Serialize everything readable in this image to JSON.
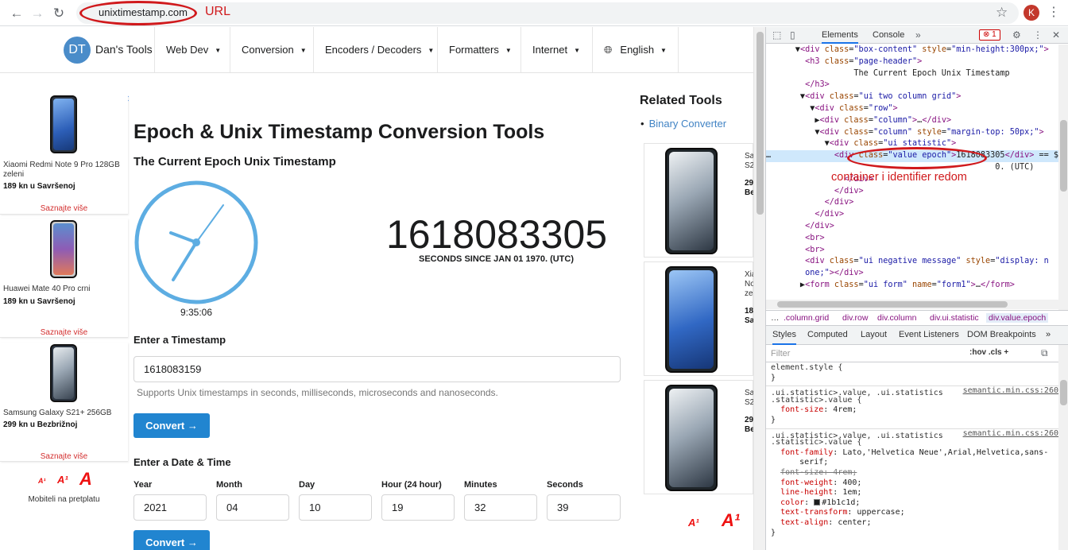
{
  "browser": {
    "url": "unixtimestamp.com",
    "url_annotation": "URL",
    "back_icon": "back-arrow-icon",
    "forward_icon": "forward-arrow-icon",
    "reload_icon": "reload-icon",
    "profile_initial": "K"
  },
  "site": {
    "logo_text": "DT",
    "brand_name": "Dan's Tools",
    "menu": [
      "Web Dev",
      "Conversion",
      "Encoders / Decoders",
      "Formatters",
      "Internet",
      "English"
    ]
  },
  "ads": [
    {
      "title": "Xiaomi Redmi Note 9 Pro 128GB zeleni",
      "price": "189 kn u Savršenoj",
      "link": "Saznajte više"
    },
    {
      "title": "Huawei Mate 40 Pro crni",
      "price": "189 kn u Savršenoj",
      "link": "Saznajte više"
    },
    {
      "title": "Samsung Galaxy S21+ 256GB",
      "price": "299 kn u Bezbrižnoj",
      "link": "Saznajte više"
    }
  ],
  "a1_caption": "Mobiteli na pretplatu",
  "main": {
    "title": "Epoch & Unix Timestamp Conversion Tools",
    "subtitle": "The Current Epoch Unix Timestamp",
    "clock_time": "9:35:06",
    "epoch_value": "1618083305",
    "epoch_label": "SECONDS SINCE JAN 01 1970. (UTC)",
    "enter_timestamp_label": "Enter a Timestamp",
    "timestamp_value": "1618083159",
    "timestamp_hint": "Supports Unix timestamps in seconds, milliseconds, microseconds and nanoseconds.",
    "convert_label": "Convert →",
    "enter_date_label": "Enter a Date & Time",
    "date_fields": [
      {
        "label": "Year",
        "value": "2021"
      },
      {
        "label": "Month",
        "value": "04"
      },
      {
        "label": "Day",
        "value": "10"
      },
      {
        "label": "Hour (24 hour)",
        "value": "19"
      },
      {
        "label": "Minutes",
        "value": "32"
      },
      {
        "label": "Seconds",
        "value": "39"
      }
    ]
  },
  "sidebar": {
    "title": "Related Tools",
    "link": "Binary Converter",
    "products": [
      {
        "t1": "Sa",
        "t2": "S2",
        "b1": "29",
        "b2": "Be"
      },
      {
        "t1": "Xia",
        "t2": "No",
        "t3": "ze",
        "b1": "18",
        "b2": "Sa"
      },
      {
        "t1": "Sa",
        "t2": "S2",
        "b1": "29",
        "b2": "Be"
      }
    ]
  },
  "devtools": {
    "tabs": [
      "Elements",
      "Console"
    ],
    "error_count": "1",
    "annotation": "container i identifier redom",
    "dom_utc_fragment": "0. (UTC)",
    "crumbs": [
      "…",
      ".column.grid",
      "div.row",
      "div.column",
      "div.ui.statistic",
      "div.value.epoch"
    ],
    "style_tabs": [
      "Styles",
      "Computed",
      "Layout",
      "Event Listeners",
      "DOM Breakpoints"
    ],
    "filter_placeholder": "Filter",
    "filter_tools": ":hov  .cls  +",
    "source_file": "semantic.min.css:260"
  },
  "colors": {
    "accent": "#2185d0",
    "annotation_red": "#d0191c",
    "clock_blue": "#5dade2"
  }
}
